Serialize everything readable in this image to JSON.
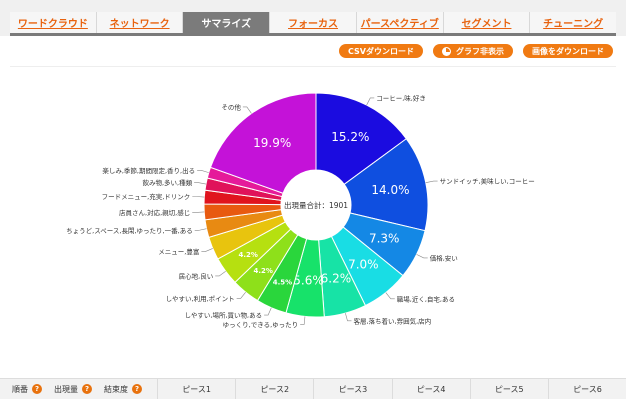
{
  "tabs": [
    "ワードクラウド",
    "ネットワーク",
    "サマライズ",
    "フォーカス",
    "パースペクティブ",
    "セグメント",
    "チューニング"
  ],
  "active_tab": "サマライズ",
  "actions": {
    "csv": "CSVダウンロード",
    "hide_graph": "グラフ非表示",
    "save_image": "画像をダウンロード"
  },
  "colors": {
    "accent": "#f07a12",
    "active_tab_bg": "#7b7b7b"
  },
  "center_label": "出現量合計：1901",
  "chart_data": {
    "type": "pie",
    "donut": true,
    "total": 1901,
    "slices": [
      {
        "label": "コーヒー,味,好き",
        "value": 15.2,
        "pct_label": "15.2%",
        "color": "#1b0ce0"
      },
      {
        "label": "サンドイッチ,美味しい,コーヒー",
        "value": 14.0,
        "pct_label": "14.0%",
        "color": "#0f4fe0"
      },
      {
        "label": "価格,安い",
        "value": 7.3,
        "pct_label": "7.3%",
        "color": "#1488e5"
      },
      {
        "label": "職場,近く,自宅,ある",
        "value": 7.0,
        "pct_label": "7.0%",
        "color": "#19dde4"
      },
      {
        "label": "客層,落ち着い,雰囲気,店内",
        "value": 6.2,
        "pct_label": "6.2%",
        "color": "#17e3a6"
      },
      {
        "label": "ゆっくり,できる,ゆったり",
        "value": 5.6,
        "pct_label": "5.6%",
        "color": "#17e26a"
      },
      {
        "label": "しやすい,場所,買い物,ある",
        "value": 4.5,
        "pct_label": "4.5%",
        "color": "#2ad63c"
      },
      {
        "label": "しやすい,利用,ポイント",
        "value": 4.2,
        "pct_label": "4.2%",
        "color": "#8ee01a"
      },
      {
        "label": "居心地,良い",
        "value": 4.2,
        "pct_label": "4.2%",
        "color": "#b6e010"
      },
      {
        "label": "メニュー,豊富",
        "value": 3.4,
        "pct_label": "",
        "color": "#e8c40e"
      },
      {
        "label": "ちょうど,スペース,長閑,ゆったり,一番,ある",
        "value": 2.6,
        "pct_label": "",
        "color": "#e88a12"
      },
      {
        "label": "店員さん,対応,親切,感じ",
        "value": 2.3,
        "pct_label": "",
        "color": "#e85a10"
      },
      {
        "label": "フードメニュー,充実,ドリンク",
        "value": 2.0,
        "pct_label": "",
        "color": "#e0141e"
      },
      {
        "label": "飲み物,多い,種類",
        "value": 1.8,
        "pct_label": "",
        "color": "#e0125a"
      },
      {
        "label": "楽しみ,季節,期間限定,香り,出る",
        "value": 1.6,
        "pct_label": "",
        "color": "#e51a9a"
      },
      {
        "label": "その他",
        "value": 19.9,
        "pct_label": "19.9%",
        "color": "#c412d8"
      }
    ]
  },
  "footer": {
    "order": "順番",
    "count": "出現量",
    "connection": "結束度",
    "help": "?",
    "pieces": [
      "ピース1",
      "ピース2",
      "ピース3",
      "ピース4",
      "ピース5",
      "ピース6"
    ]
  }
}
